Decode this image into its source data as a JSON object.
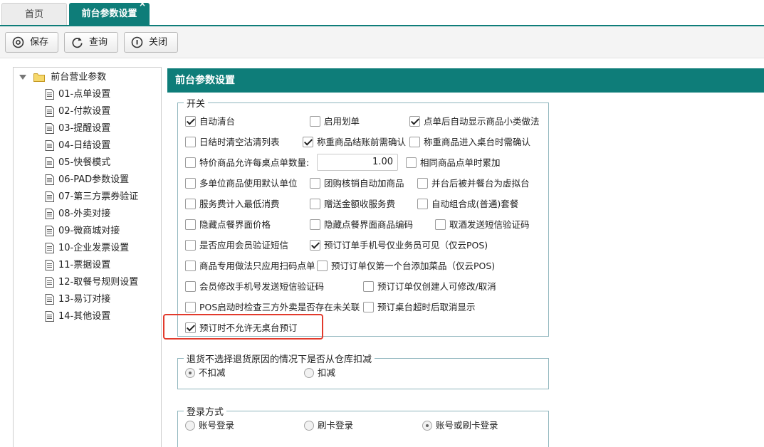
{
  "tabs": [
    {
      "label": "首页",
      "active": false
    },
    {
      "label": "前台参数设置",
      "active": true
    }
  ],
  "tab_close_glyph": "×",
  "toolbar": {
    "save": "保存",
    "query": "查询",
    "close": "关闭"
  },
  "tree": {
    "root": "前台营业参数",
    "items": [
      "01-点单设置",
      "02-付款设置",
      "03-提醒设置",
      "04-日结设置",
      "05-快餐模式",
      "06-PAD参数设置",
      "07-第三方票券验证",
      "08-外卖对接",
      "09-微商城对接",
      "10-企业发票设置",
      "11-票据设置",
      "12-取餐号规则设置",
      "13-易订对接",
      "14-其他设置"
    ]
  },
  "main": {
    "title": "前台参数设置",
    "switch_legend": "开关",
    "checkboxes": [
      {
        "label": "自动清台",
        "checked": true
      },
      {
        "label": "启用划单",
        "checked": false
      },
      {
        "label": "点单后自动显示商品小类做法",
        "checked": true
      },
      {
        "label": "日结时清空沽清列表",
        "checked": false
      },
      {
        "label": "称重商品结账前需确认",
        "checked": true
      },
      {
        "label": "称重商品进入桌台时需确认",
        "checked": false
      },
      {
        "label": "特价商品允许每桌点单数量:",
        "checked": false
      },
      {
        "label": "相同商品点单时累加",
        "checked": false
      },
      {
        "label": "多单位商品使用默认单位",
        "checked": false
      },
      {
        "label": "团购核销自动加商品",
        "checked": false
      },
      {
        "label": "并台后被并餐台为虚拟台",
        "checked": false
      },
      {
        "label": "服务费计入最低消费",
        "checked": false
      },
      {
        "label": "赠送金额收服务费",
        "checked": false
      },
      {
        "label": "自动组合成(普通)套餐",
        "checked": false
      },
      {
        "label": "隐藏点餐界面价格",
        "checked": false
      },
      {
        "label": "隐藏点餐界面商品编码",
        "checked": false
      },
      {
        "label": "取酒发送短信验证码",
        "checked": false
      },
      {
        "label": "是否应用会员验证短信",
        "checked": false
      },
      {
        "label": "预订订单手机号仅业务员可见（仅云POS)",
        "checked": true
      },
      {
        "label": "商品专用做法只应用扫码点单",
        "checked": false
      },
      {
        "label": "预订订单仅第一个台添加菜品（仅云POS)",
        "checked": false
      },
      {
        "label": "会员修改手机号发送短信验证码",
        "checked": false
      },
      {
        "label": "预订订单仅创建人可修改/取消",
        "checked": false
      },
      {
        "label": "POS启动时检查三方外卖是否存在未关联",
        "checked": false
      },
      {
        "label": "预订桌台超时后取消显示",
        "checked": false
      },
      {
        "label": "预订时不允许无桌台预订",
        "checked": true
      }
    ],
    "special_qty": "1.00",
    "return_legend": "退货不选择退货原因的情况下是否从仓库扣减",
    "return_options": [
      {
        "label": "不扣减",
        "selected": true
      },
      {
        "label": "扣减",
        "selected": false
      }
    ],
    "login_legend": "登录方式",
    "login_options": [
      {
        "label": "账号登录",
        "selected": false
      },
      {
        "label": "刷卡登录",
        "selected": false
      },
      {
        "label": "账号或刷卡登录",
        "selected": true
      }
    ]
  },
  "colors": {
    "accent": "#0e7d79",
    "highlight": "#e23a2c",
    "fieldset_border": "#8fb5bd"
  }
}
